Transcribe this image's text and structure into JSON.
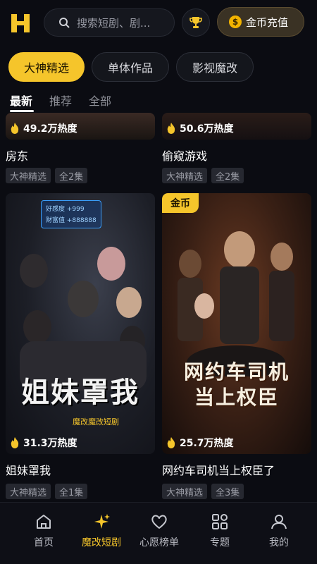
{
  "header": {
    "search_placeholder": "搜索短剧、剧...",
    "recharge_label": "金币充值",
    "coin_symbol": "$"
  },
  "categories": [
    {
      "label": "大神精选",
      "active": true
    },
    {
      "label": "单体作品",
      "active": false
    },
    {
      "label": "影视魔改",
      "active": false
    }
  ],
  "subtabs": [
    {
      "label": "最新",
      "active": true
    },
    {
      "label": "推荐",
      "active": false
    },
    {
      "label": "全部",
      "active": false
    }
  ],
  "cards": [
    {
      "heat": "49.2万热度",
      "title": "房东",
      "tags": [
        "大神精选",
        "全2集"
      ]
    },
    {
      "heat": "50.6万热度",
      "title": "偷窥游戏",
      "tags": [
        "大神精选",
        "全2集"
      ]
    },
    {
      "heat": "31.3万热度",
      "title": "姐妹罩我",
      "tags": [
        "大神精选",
        "全1集"
      ],
      "poster_title": "姐妹罩我",
      "poster_sub": "魔改魔改短剧",
      "screen_line1": "好感度 +999",
      "screen_line2": "财富值 +888888"
    },
    {
      "heat": "25.7万热度",
      "title": "网约车司机当上权臣了",
      "tags": [
        "大神精选",
        "全3集"
      ],
      "badge": "金币",
      "poster_title_1": "网约车司机",
      "poster_title_2": "当上权臣"
    }
  ],
  "nav": [
    {
      "label": "首页",
      "icon": "home-icon",
      "active": false
    },
    {
      "label": "魔改短剧",
      "icon": "sparkle-icon",
      "active": true
    },
    {
      "label": "心愿榜单",
      "icon": "heart-icon",
      "active": false
    },
    {
      "label": "专题",
      "icon": "grid-icon",
      "active": false
    },
    {
      "label": "我的",
      "icon": "profile-icon",
      "active": false
    }
  ],
  "colors": {
    "accent": "#f5c52b",
    "background": "#0b0c12"
  }
}
